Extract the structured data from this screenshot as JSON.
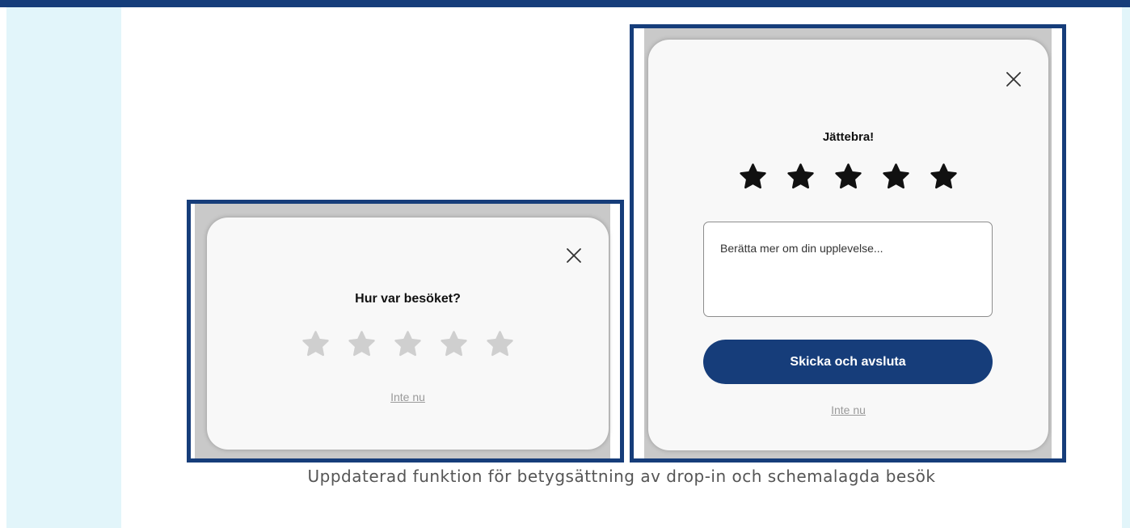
{
  "colors": {
    "brand_blue": "#163d7a",
    "side_panel": "#e2f5fa",
    "star_empty": "#cfcfcf",
    "star_filled": "#111111",
    "link_gray": "#9a9a9a"
  },
  "rating_dialog_initial": {
    "title": "Hur var besöket?",
    "stars_filled": 0,
    "stars_total": 5,
    "skip_label": "Inte nu",
    "close_icon": "close-icon",
    "star_icon": "star-icon"
  },
  "rating_dialog_rated": {
    "title": "Jättebra!",
    "stars_filled": 5,
    "stars_total": 5,
    "feedback_placeholder": "Berätta mer om din upplevelse...",
    "submit_label": "Skicka och avsluta",
    "skip_label": "Inte nu",
    "close_icon": "close-icon",
    "star_icon": "star-icon"
  },
  "caption": "Uppdaterad funktion för betygsättning av drop-in och schemalagda besök"
}
